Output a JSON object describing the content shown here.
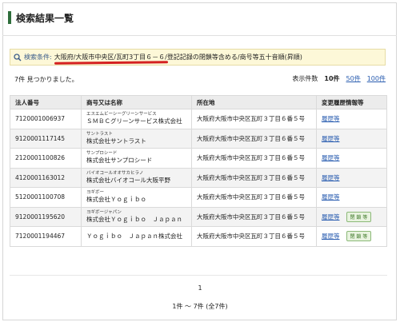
{
  "page": {
    "title": "検索結果一覧"
  },
  "conditions": {
    "label": "検索条件:",
    "text": "大阪府/大阪市中央区/瓦町3丁目６－６/登記記録の閉鎖等含める/商号等五十音順(昇順)"
  },
  "summary": {
    "count_text": "7件 見つかりました。",
    "per_page_label": "表示件数",
    "per_page_selected": "10件",
    "per_page_options": [
      "50件",
      "100件"
    ]
  },
  "table": {
    "headers": [
      "法人番号",
      "商号又は名称",
      "所在地",
      "変更履歴情報等"
    ],
    "rows": [
      {
        "number": "7120001006937",
        "kana": "エスエムビーシーグリーンサービス",
        "name": "ＳＭＢＣグリーンサービス株式会社",
        "address": "大阪府大阪市中央区瓦町３丁目６番５号",
        "history": "履歴等",
        "badge": ""
      },
      {
        "number": "9120001117145",
        "kana": "サントラスト",
        "name": "株式会社サントラスト",
        "address": "大阪府大阪市中央区瓦町３丁目６番５号",
        "history": "履歴等",
        "badge": ""
      },
      {
        "number": "2120001100826",
        "kana": "サンプロシード",
        "name": "株式会社サンプロシード",
        "address": "大阪府大阪市中央区瓦町３丁目６番５号",
        "history": "履歴等",
        "badge": ""
      },
      {
        "number": "4120001163012",
        "kana": "バイオコールオオサカヒラノ",
        "name": "株式会社バイオコール大阪平野",
        "address": "大阪府大阪市中央区瓦町３丁目６番５号",
        "history": "履歴等",
        "badge": ""
      },
      {
        "number": "5120001100708",
        "kana": "ヨギボー",
        "name": "株式会社Ｙｏｇｉｂｏ",
        "address": "大阪府大阪市中央区瓦町３丁目６番５号",
        "history": "履歴等",
        "badge": ""
      },
      {
        "number": "9120001195620",
        "kana": "ヨギボージャパン",
        "name": "株式会社Ｙｏｇｉｂｏ　Ｊａｐａｎ",
        "address": "大阪府大阪市中央区瓦町３丁目６番５号",
        "history": "履歴等",
        "badge": "閉 鎖 等"
      },
      {
        "number": "7120001194467",
        "kana": "",
        "name": "Ｙｏｇｉｂｏ　Ｊａｐａｎ株式会社",
        "address": "大阪府大阪市中央区瓦町３丁目６番５号",
        "history": "履歴等",
        "badge": "閉 鎖 等"
      }
    ]
  },
  "pagination": {
    "current_page": "1",
    "range_text": "1件 ～ 7件 (全7件)"
  },
  "colors": {
    "accent": "#2f6e3c",
    "link": "#2a5db0",
    "highlight_bg": "#fdf8d8",
    "underline": "#d42020"
  },
  "icons": {
    "search": "search-icon"
  }
}
